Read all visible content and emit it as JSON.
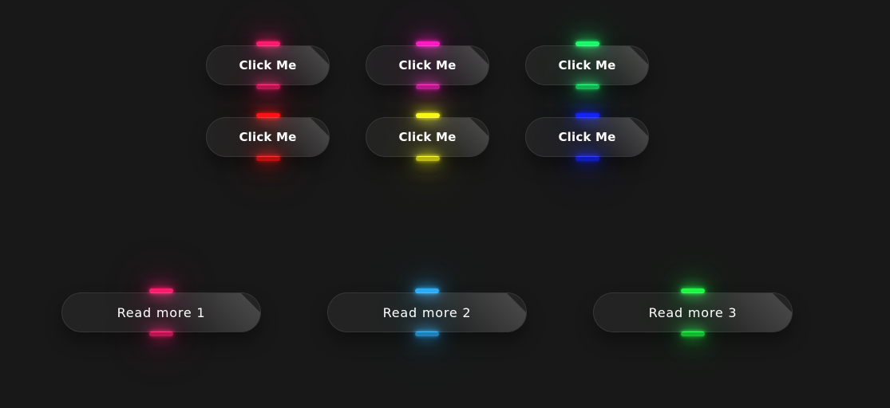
{
  "small_buttons": [
    {
      "label": "Click Me",
      "glow_color": "#ff1f71"
    },
    {
      "label": "Click Me",
      "glow_color": "#ff1fc7"
    },
    {
      "label": "Click Me",
      "glow_color": "#1eff6f"
    },
    {
      "label": "Click Me",
      "glow_color": "#ff1616"
    },
    {
      "label": "Click Me",
      "glow_color": "#ffff1a"
    },
    {
      "label": "Click Me",
      "glow_color": "#1626ff"
    }
  ],
  "large_buttons": [
    {
      "label": "Read more 1",
      "glow_color": "#ff1f71"
    },
    {
      "label": "Read more 2",
      "glow_color": "#2db2ff"
    },
    {
      "label": "Read more 3",
      "glow_color": "#1eff45"
    }
  ]
}
